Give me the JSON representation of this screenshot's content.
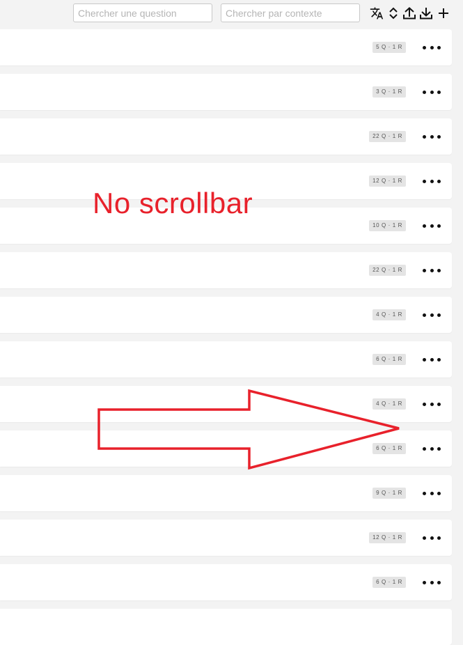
{
  "toolbar": {
    "question_search_placeholder": "Chercher une question",
    "context_search_placeholder": "Chercher par contexte",
    "icons": [
      "translate-icon",
      "sort-icon",
      "upload-icon",
      "download-icon",
      "plus-icon"
    ]
  },
  "rows": [
    {
      "badge": "5 Q · 1 R"
    },
    {
      "badge": "3 Q · 1 R"
    },
    {
      "badge": "22 Q · 1 R"
    },
    {
      "badge": "12 Q · 1 R"
    },
    {
      "badge": "10 Q · 1 R"
    },
    {
      "badge": "22 Q · 1 R"
    },
    {
      "badge": "4 Q · 1 R"
    },
    {
      "badge": "6 Q · 1 R"
    },
    {
      "badge": "4 Q · 1 R"
    },
    {
      "badge": "6 Q · 1 R"
    },
    {
      "badge": "9 Q · 1 R"
    },
    {
      "badge": "12 Q · 1 R"
    },
    {
      "badge": "6 Q · 1 R"
    }
  ],
  "annotation": {
    "text": "No scrollbar",
    "color": "#e8212b"
  }
}
